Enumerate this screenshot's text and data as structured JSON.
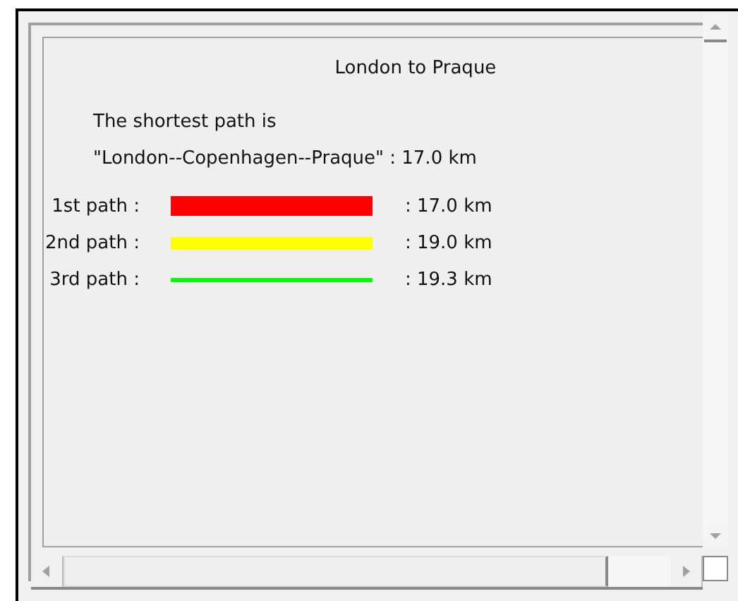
{
  "title": "London to Praque",
  "summary": [
    "The shortest path is",
    "\"London--Copenhagen--Praque\" : 17.0 km"
  ],
  "paths": [
    {
      "label": "1st path :",
      "color": "#ff0000",
      "kind": "thick",
      "distance": ": 17.0 km"
    },
    {
      "label": "2nd path :",
      "color": "#ffff00",
      "kind": "medium",
      "distance": ": 19.0 km"
    },
    {
      "label": "3rd path :",
      "color": "#00ff00",
      "kind": "thin",
      "distance": ": 19.3 km"
    }
  ]
}
